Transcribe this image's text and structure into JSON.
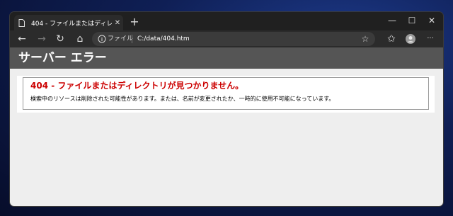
{
  "tab": {
    "title": "404 - ファイルまたはディレクトリが見つ",
    "close": "✕"
  },
  "window_controls": {
    "minimize": "—",
    "maximize": "☐",
    "close": "✕"
  },
  "newtab": "+",
  "toolbar": {
    "back": "←",
    "forward": "→",
    "refresh": "↻",
    "home": "⌂",
    "scheme_label": "ファイル",
    "url": "C:/data/404.htm",
    "favorite": "☆",
    "favorites_menu": "✩",
    "more": "···"
  },
  "page": {
    "header": "サーバー エラー",
    "error_title": "404 - ファイルまたはディレクトリが見つかりません。",
    "error_message": "検索中のリソースは削除された可能性があります。または、名前が変更されたか、一時的に使用不可能になっています。"
  },
  "colors": {
    "error_red": "#cc0000",
    "header_bg": "#555555",
    "content_bg": "#eeeeee"
  }
}
